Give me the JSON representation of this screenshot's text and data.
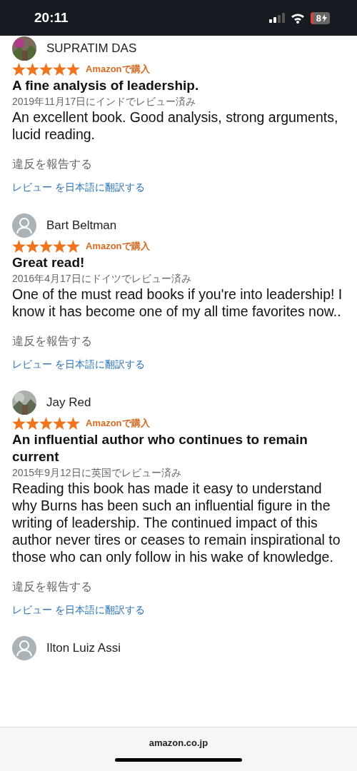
{
  "status_bar": {
    "time": "20:11",
    "battery": "8"
  },
  "reviews": [
    {
      "name": "SUPRATIM DAS",
      "stars": 5,
      "badge": "Amazonで購入",
      "title": "A fine analysis of leadership.",
      "date": "2019年11月17日にインドでレビュー済み",
      "body": "An excellent book. Good analysis, strong arguments, lucid reading.",
      "report": "違反を報告する",
      "translate": "レビュー を日本語に翻訳する"
    },
    {
      "avatar": {
        "kind": "default"
      },
      "name": "Bart Beltman",
      "stars": 5,
      "badge": "Amazonで購入",
      "title": "Great read!",
      "date": "2016年4月17日にドイツでレビュー済み",
      "body": "One of the must read books if you're into leadership! I know it has become one of my all time favorites now..",
      "report": "違反を報告する",
      "translate": "レビュー を日本語に翻訳する"
    },
    {
      "name": "Jay Red",
      "stars": 5,
      "badge": "Amazonで購入",
      "title": "An influential author who continues to remain current",
      "date": "2015年9月12日に英国でレビュー済み",
      "body": "Reading this book has made it easy to understand why Burns has been such an influential figure in the writing of leadership. The continued impact of this author never tires or ceases to remain inspirational to those who can only follow in his wake of knowledge.",
      "report": "違反を報告する",
      "translate": "レビュー を日本語に翻訳する"
    },
    {
      "avatar": {
        "kind": "default"
      },
      "name": "Ilton Luiz Assi"
    }
  ],
  "address_bar": {
    "url": "amazon.co.jp"
  }
}
